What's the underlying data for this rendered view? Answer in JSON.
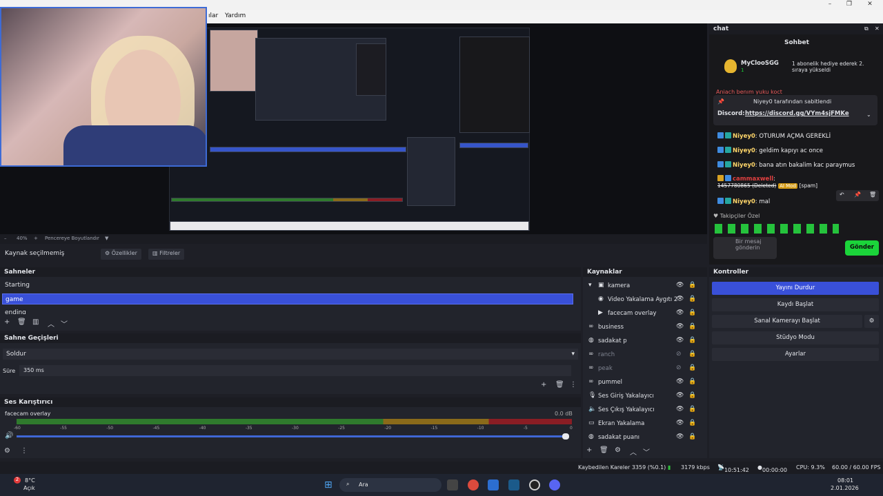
{
  "menu": {
    "items": [
      "ılar",
      "Yardım"
    ]
  },
  "window_controls": {
    "minimize": "–",
    "maximize": "❐",
    "close": "✕"
  },
  "zoom": {
    "level": "40%",
    "plus": "+",
    "fit_label": "Pencereye Boyutlandır"
  },
  "source_bar": {
    "status": "Kaynak seçilmemiş",
    "properties": "Özellikler",
    "filters": "Filtreler"
  },
  "scenes": {
    "title": "Sahneler",
    "items": [
      "Starting",
      "game",
      "ending"
    ],
    "selected": "game"
  },
  "transitions": {
    "title": "Sahne Geçişleri",
    "selected": "Soldur",
    "duration_label": "Süre",
    "duration_value": "350 ms"
  },
  "mixer": {
    "title": "Ses Karıştırıcı",
    "track_name": "facecam overlay",
    "db": "0.0 dB",
    "ticks": [
      "-60",
      "-55",
      "-50",
      "-45",
      "-40",
      "-35",
      "-30",
      "-25",
      "-20",
      "-15",
      "-10",
      "-5",
      "0"
    ],
    "volume": 1.0
  },
  "sources": {
    "title": "Kaynaklar",
    "items": [
      {
        "name": "kamera",
        "icon": "folder-icon",
        "visible": true
      },
      {
        "name": "Video Yakalama Aygıtı 2",
        "icon": "camera-icon",
        "visible": true
      },
      {
        "name": "facecam overlay",
        "icon": "play-icon",
        "visible": true
      },
      {
        "name": "business",
        "icon": "link-icon",
        "visible": true
      },
      {
        "name": "sadakat p",
        "icon": "globe-icon",
        "visible": true
      },
      {
        "name": "ranch",
        "icon": "link-icon",
        "visible": false
      },
      {
        "name": "peak",
        "icon": "link-icon",
        "visible": false
      },
      {
        "name": "pummel",
        "icon": "link-icon",
        "visible": true
      },
      {
        "name": "Ses Giriş Yakalayıcı",
        "icon": "mic-icon",
        "visible": true
      },
      {
        "name": "Ses Çıkış Yakalayıcı",
        "icon": "speaker-icon",
        "visible": true
      },
      {
        "name": "Ekran Yakalama",
        "icon": "monitor-icon",
        "visible": true
      },
      {
        "name": "sadakat puanı",
        "icon": "globe-icon",
        "visible": true
      }
    ]
  },
  "controls": {
    "title": "Kontroller",
    "buttons": [
      "Yayını Durdur",
      "Kaydı Başlat",
      "Sanal Kamerayı Başlat",
      "Stüdyo Modu",
      "Ayarlar"
    ]
  },
  "chat": {
    "dock_title": "chat",
    "header": "Sohbet",
    "gift_user": "MyClooSGG",
    "gift_text": "1 abonelik hediye ederek 2. sıraya yükseldi",
    "gift_count": "1",
    "obscured_line": "Aniach benım yuku koct",
    "pinned_by": "Niyey0 tarafından sabitlendi",
    "pinned_label": "Discord:",
    "pinned_link": "https://discord.gg/VYm4sjFMKe",
    "messages": [
      {
        "user": "Niyey0",
        "text": "OTURUM AÇMA GEREKLİ"
      },
      {
        "user": "Niyey0",
        "text": "geldim kapıyı ac once"
      },
      {
        "user": "Niyey0",
        "text": "bana atın bakalim kac paraymus"
      },
      {
        "user": "cammaxwell",
        "text": "1457780865 (Deleted)",
        "mod_badge": "AI Mod",
        "tag": "[spam]"
      },
      {
        "user": "Niyey0",
        "text": "mal"
      }
    ],
    "followers_label": "Takipçiler Özel",
    "input_placeholder": "Bir mesaj gönderin",
    "send": "Gönder"
  },
  "status": {
    "dropped": "Kaybedilen Kareler 3359 (%0.1)",
    "bitrate": "3179 kbps",
    "stream_time": "10:51:42",
    "rec_time": "00:00:00",
    "cpu": "CPU: 9.3%",
    "fps": "60.00 / 60.00 FPS"
  },
  "taskbar": {
    "weather_temp": "8°C",
    "weather_desc": "Açık",
    "weather_badge": "2",
    "search": "Ara",
    "time": "08:01",
    "date": "2.01.2026"
  }
}
